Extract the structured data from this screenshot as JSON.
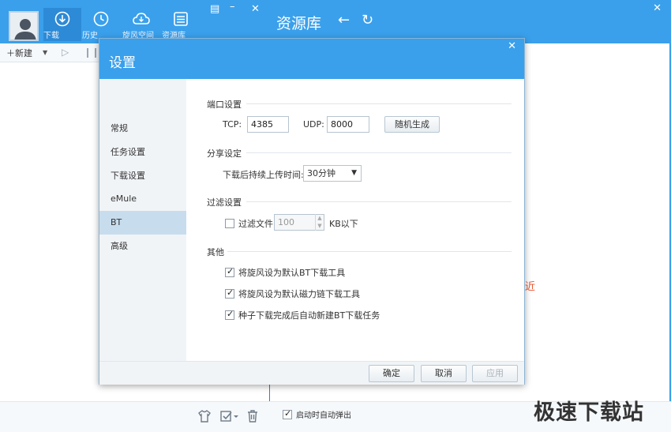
{
  "app": {
    "nav": [
      {
        "label": "下载",
        "icon": "download-icon"
      },
      {
        "label": "历史",
        "icon": "history-icon"
      },
      {
        "label": "旋风空间",
        "icon": "cloud-space-icon"
      },
      {
        "label": "资源库",
        "icon": "resource-library-icon"
      }
    ],
    "toolbar": {
      "new_label": "＋新建"
    },
    "accent": "#3aa0ec"
  },
  "library": {
    "title": "资源库",
    "red_fragment": "近",
    "autostart_label": "启动时自动弹出",
    "autostart_checked": true
  },
  "watermark": "极速下载站",
  "dialog": {
    "title": "设置",
    "sidebar": [
      {
        "label": "常规",
        "active": false
      },
      {
        "label": "任务设置",
        "active": false
      },
      {
        "label": "下载设置",
        "active": false
      },
      {
        "label": "eMule",
        "active": false
      },
      {
        "label": "BT",
        "active": true
      },
      {
        "label": "高级",
        "active": false
      }
    ],
    "port": {
      "group": "端口设置",
      "tcp_label": "TCP:",
      "tcp_value": "4385",
      "udp_label": "UDP:",
      "udp_value": "8000",
      "random_button": "随机生成"
    },
    "share": {
      "group": "分享设定",
      "label": "下载后持续上传时间:",
      "value": "30分钟"
    },
    "filter": {
      "group": "过滤设置",
      "checkbox_label": "过滤文件",
      "checked": false,
      "value": "100",
      "unit": "KB以下"
    },
    "other": {
      "group": "其他",
      "options": [
        {
          "label": "将旋风设为默认BT下载工具",
          "checked": true
        },
        {
          "label": "将旋风设为默认磁力链下载工具",
          "checked": true
        },
        {
          "label": "种子下载完成后自动新建BT下载任务",
          "checked": true
        }
      ]
    },
    "footer": {
      "ok": "确定",
      "cancel": "取消",
      "apply": "应用"
    }
  }
}
